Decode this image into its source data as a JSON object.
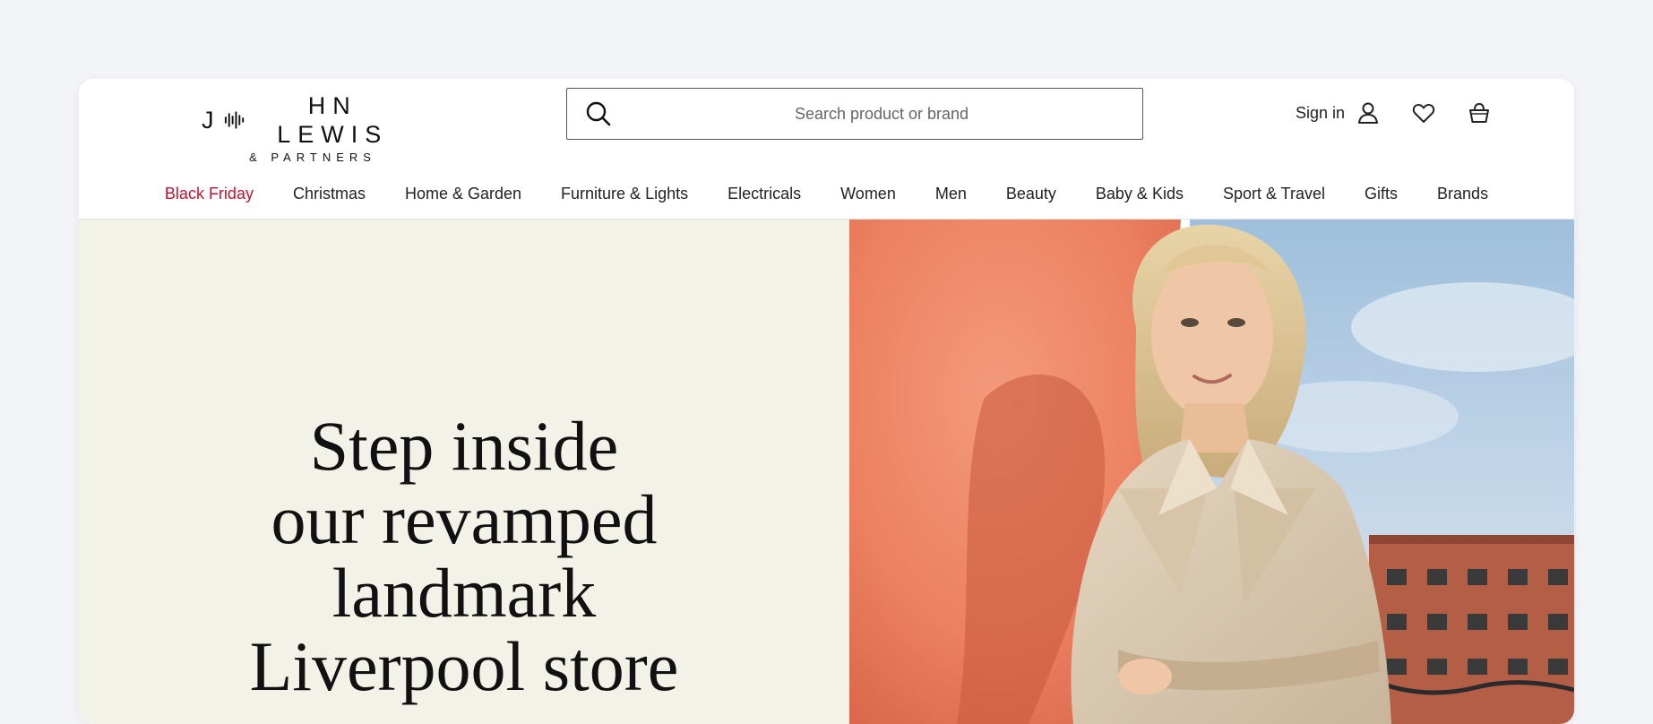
{
  "brand": {
    "logo_line1": "J HN LEWIS",
    "logo_line2": "& PARTNERS"
  },
  "search": {
    "placeholder": "Search product or brand",
    "icon": "search-icon"
  },
  "account": {
    "sign_in_label": "Sign in",
    "user_icon": "user-icon",
    "wishlist_icon": "heart-icon",
    "basket_icon": "basket-icon"
  },
  "nav": {
    "items": [
      {
        "label": "Black Friday",
        "highlight": true
      },
      {
        "label": "Christmas"
      },
      {
        "label": "Home & Garden"
      },
      {
        "label": "Furniture & Lights"
      },
      {
        "label": "Electricals"
      },
      {
        "label": "Women"
      },
      {
        "label": "Men"
      },
      {
        "label": "Beauty"
      },
      {
        "label": "Baby & Kids"
      },
      {
        "label": "Sport & Travel"
      },
      {
        "label": "Gifts"
      },
      {
        "label": "Brands"
      }
    ]
  },
  "hero": {
    "title_lines": [
      "Step inside",
      "our revamped",
      "landmark",
      "Liverpool store"
    ],
    "image_alt": "Woman in a beige trench coat leaning against an orange wall"
  },
  "colors": {
    "sale_red": "#c8102e",
    "hero_bg": "#f3f2e8",
    "page_bg": "#f3f4f8"
  }
}
